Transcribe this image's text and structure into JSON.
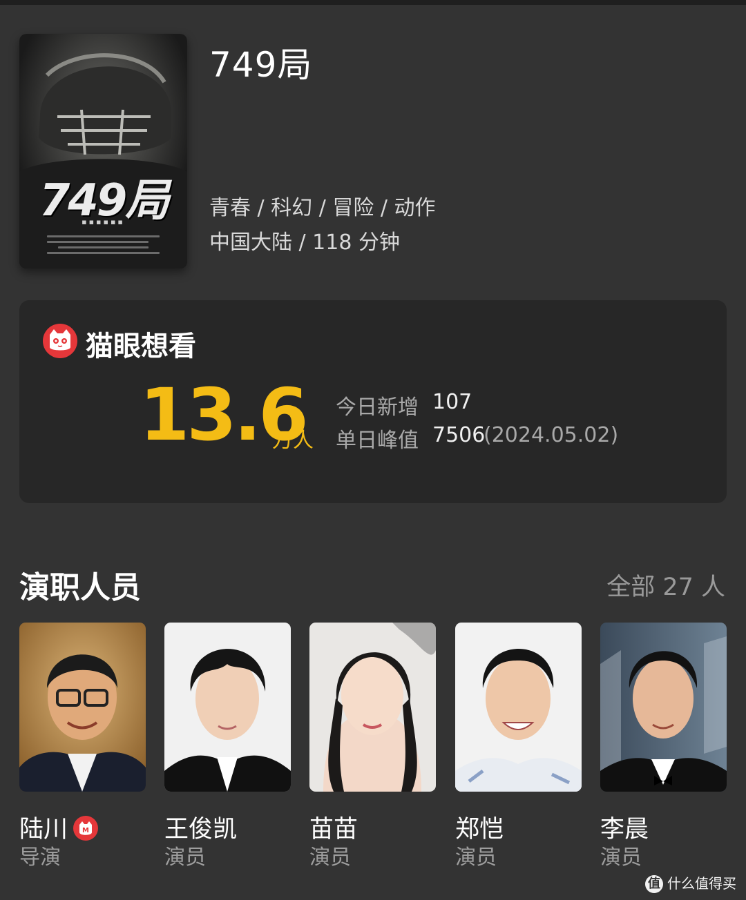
{
  "movie": {
    "title": "749局",
    "poster_title": "749局",
    "genres": "青春 / 科幻 / 冒险 / 动作",
    "region_duration": "中国大陆 / 118 分钟"
  },
  "want_to_see": {
    "platform": "猫眼想看",
    "total_value": "13.6",
    "total_unit": "万人",
    "today_label": "今日新增",
    "today_value": "107",
    "peak_label": "单日峰值",
    "peak_value": "7506",
    "peak_date": "(2024.05.02)"
  },
  "cast_section": {
    "title": "演职人员",
    "more": "全部 27 人"
  },
  "cast": [
    {
      "name": "陆川",
      "role": "导演"
    },
    {
      "name": "王俊凯",
      "role": "演员"
    },
    {
      "name": "苗苗",
      "role": "演员"
    },
    {
      "name": "郑恺",
      "role": "演员"
    },
    {
      "name": "李晨",
      "role": "演员"
    }
  ],
  "watermark": {
    "icon": "值",
    "text": "什么值得买"
  },
  "colors": {
    "accent": "#f4bc15",
    "brand_red": "#e5373a",
    "background": "#333333",
    "card": "#272727"
  }
}
